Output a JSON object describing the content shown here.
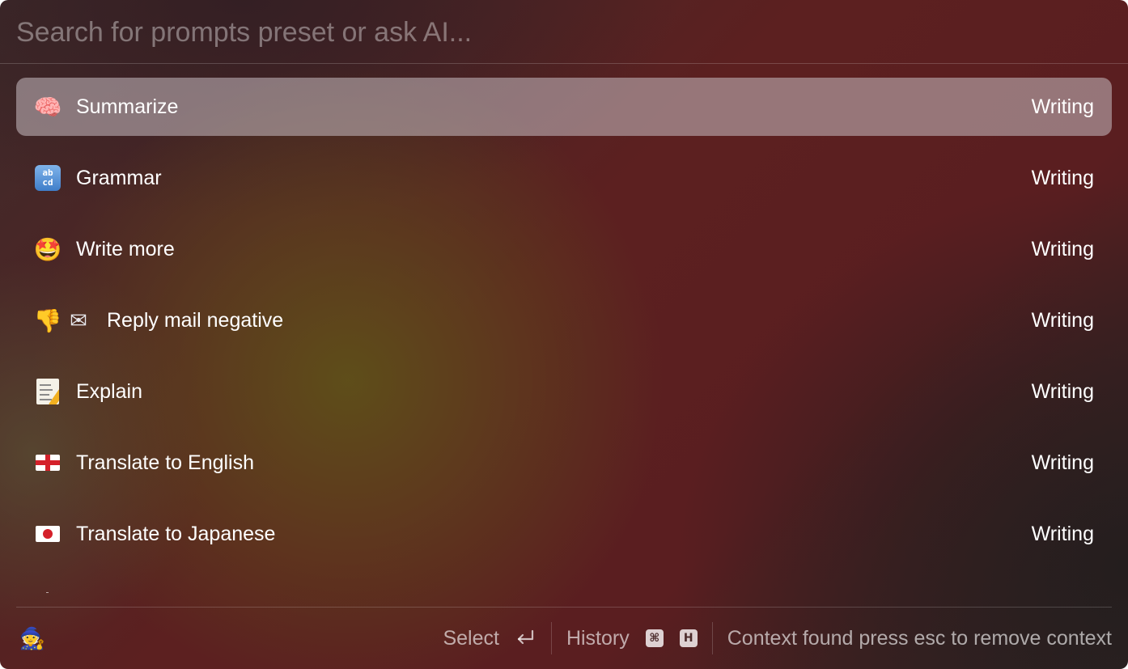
{
  "search": {
    "placeholder": "Search for prompts preset or ask AI..."
  },
  "prompts": [
    {
      "icon": "brain-icon",
      "glyph": "🧠",
      "label": "Summarize",
      "category": "Writing",
      "selected": true
    },
    {
      "icon": "abcd-icon",
      "glyph": "ab cd",
      "label": "Grammar",
      "category": "Writing",
      "selected": false
    },
    {
      "icon": "star-struck-icon",
      "glyph": "🤩",
      "label": "Write more",
      "category": "Writing",
      "selected": false
    },
    {
      "icon": "thumbs-down-envelope-icon",
      "glyph": "👎",
      "glyph2": "✉",
      "label": "Reply mail negative",
      "category": "Writing",
      "selected": false
    },
    {
      "icon": "memo-icon",
      "glyph": "📝",
      "label": "Explain",
      "category": "Writing",
      "selected": false
    },
    {
      "icon": "england-flag-icon",
      "glyph": "",
      "label": "Translate to English",
      "category": "Writing",
      "selected": false
    },
    {
      "icon": "japan-flag-icon",
      "glyph": "",
      "label": "Translate to Japanese",
      "category": "Writing",
      "selected": false
    }
  ],
  "footer": {
    "avatar_icon": "mage-icon",
    "avatar_glyph": "🧙",
    "select_label": "Select",
    "select_icon": "return-key-icon",
    "history_label": "History",
    "history_keys": [
      "⌘",
      "H"
    ],
    "context_text": "Context found press esc to remove context"
  },
  "colors": {
    "selected_row": "#a69396",
    "text": "#ffffff",
    "muted_text": "#b9a5a5",
    "background_dark_red": "#5c2020",
    "background_olive": "#5f5019"
  }
}
